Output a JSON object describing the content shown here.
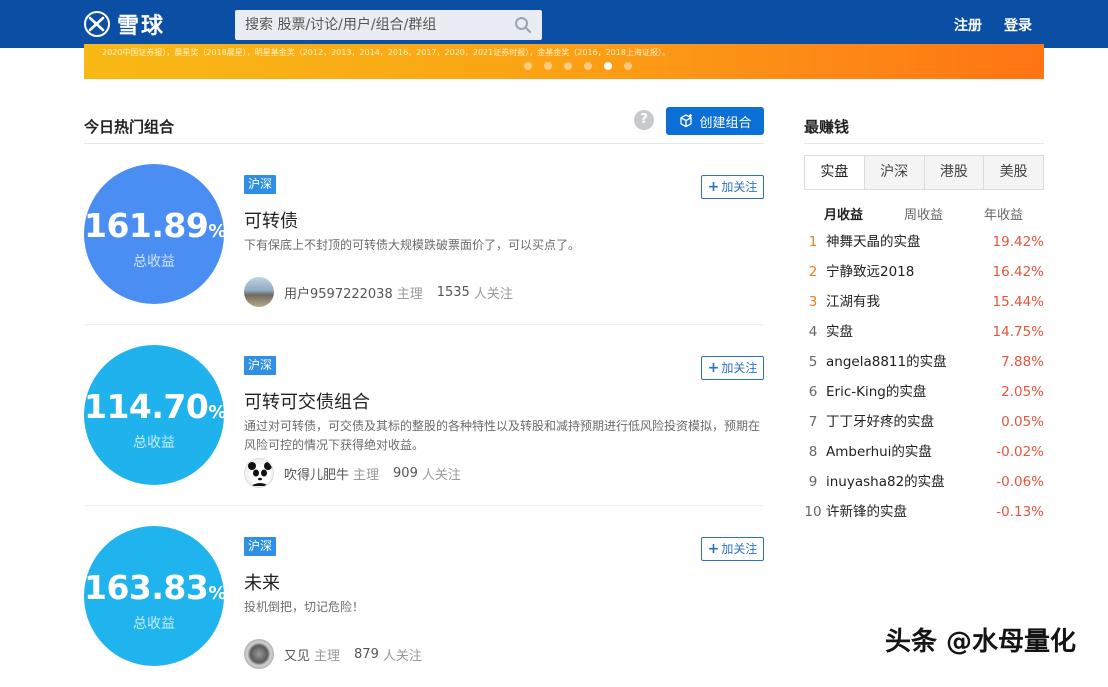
{
  "header": {
    "logo_text": "雪球",
    "search_placeholder": "搜索 股票/讨论/用户/组合/群组",
    "register": "注册",
    "login": "登录"
  },
  "banner": {
    "text": "2020中国证券报），晨星奖（2018晨星），明星基金奖（2012，2013，2014，2016，2017，2020，2021证券时报），金基金奖（2016，2018上海证报）。",
    "dots": 6,
    "active_dot": 4
  },
  "hot": {
    "title": "今日热门组合",
    "help": "?",
    "create_label": "创建组合",
    "return_label": "总收益",
    "pct": "%",
    "role": "主理",
    "fans_label": "人关注",
    "follow_label": "加关注",
    "cards": [
      {
        "market": "沪深",
        "return": "161.89",
        "name": "可转债",
        "desc": "下有保底上不封顶的可转债大规模跌破票面价了，可以买点了。",
        "owner": "用户9597222038",
        "fans": "1535"
      },
      {
        "market": "沪深",
        "return": "114.70",
        "name": "可转可交债组合",
        "desc": "通过对可转债，可交债及其标的整股的各种特性以及转股和减持预期进行低风险投资模拟，预期在风险可控的情况下获得绝对收益。",
        "owner": "吹得儿肥牛",
        "fans": "909"
      },
      {
        "market": "沪深",
        "return": "163.83",
        "name": "未来",
        "desc": "投机倒把，切记危险！",
        "owner": "又见",
        "fans": "879"
      }
    ]
  },
  "ranking": {
    "title": "最赚钱",
    "market_tabs": [
      "实盘",
      "沪深",
      "港股",
      "美股"
    ],
    "period_tabs": [
      "月收益",
      "周收益",
      "年收益"
    ],
    "rows": [
      {
        "no": "1",
        "name": "神舞天晶的实盘",
        "value": "19.42%"
      },
      {
        "no": "2",
        "name": "宁静致远2018",
        "value": "16.42%"
      },
      {
        "no": "3",
        "name": "江湖有我",
        "value": "15.44%"
      },
      {
        "no": "4",
        "name": "实盘",
        "value": "14.75%"
      },
      {
        "no": "5",
        "name": "angela8811的实盘",
        "value": "7.88%"
      },
      {
        "no": "6",
        "name": "Eric-King的实盘",
        "value": "2.05%"
      },
      {
        "no": "7",
        "name": "丁丁牙好疼的实盘",
        "value": "0.05%"
      },
      {
        "no": "8",
        "name": "Amberhui的实盘",
        "value": "-0.02%"
      },
      {
        "no": "9",
        "name": "inuyasha82的实盘",
        "value": "-0.06%"
      },
      {
        "no": "10",
        "name": "许新锋的实盘",
        "value": "-0.13%"
      }
    ]
  },
  "watermark": "头条 @水母量化",
  "colors": {
    "header_bg": "#0b4fa5",
    "accent_blue": "#0b6fd6",
    "gain_red": "#e4553d",
    "rank_orange": "#f07c1b",
    "circle_1": "#4b8ef3",
    "circle_2": "#20b2ec",
    "circle_3": "#1fb4ee"
  }
}
